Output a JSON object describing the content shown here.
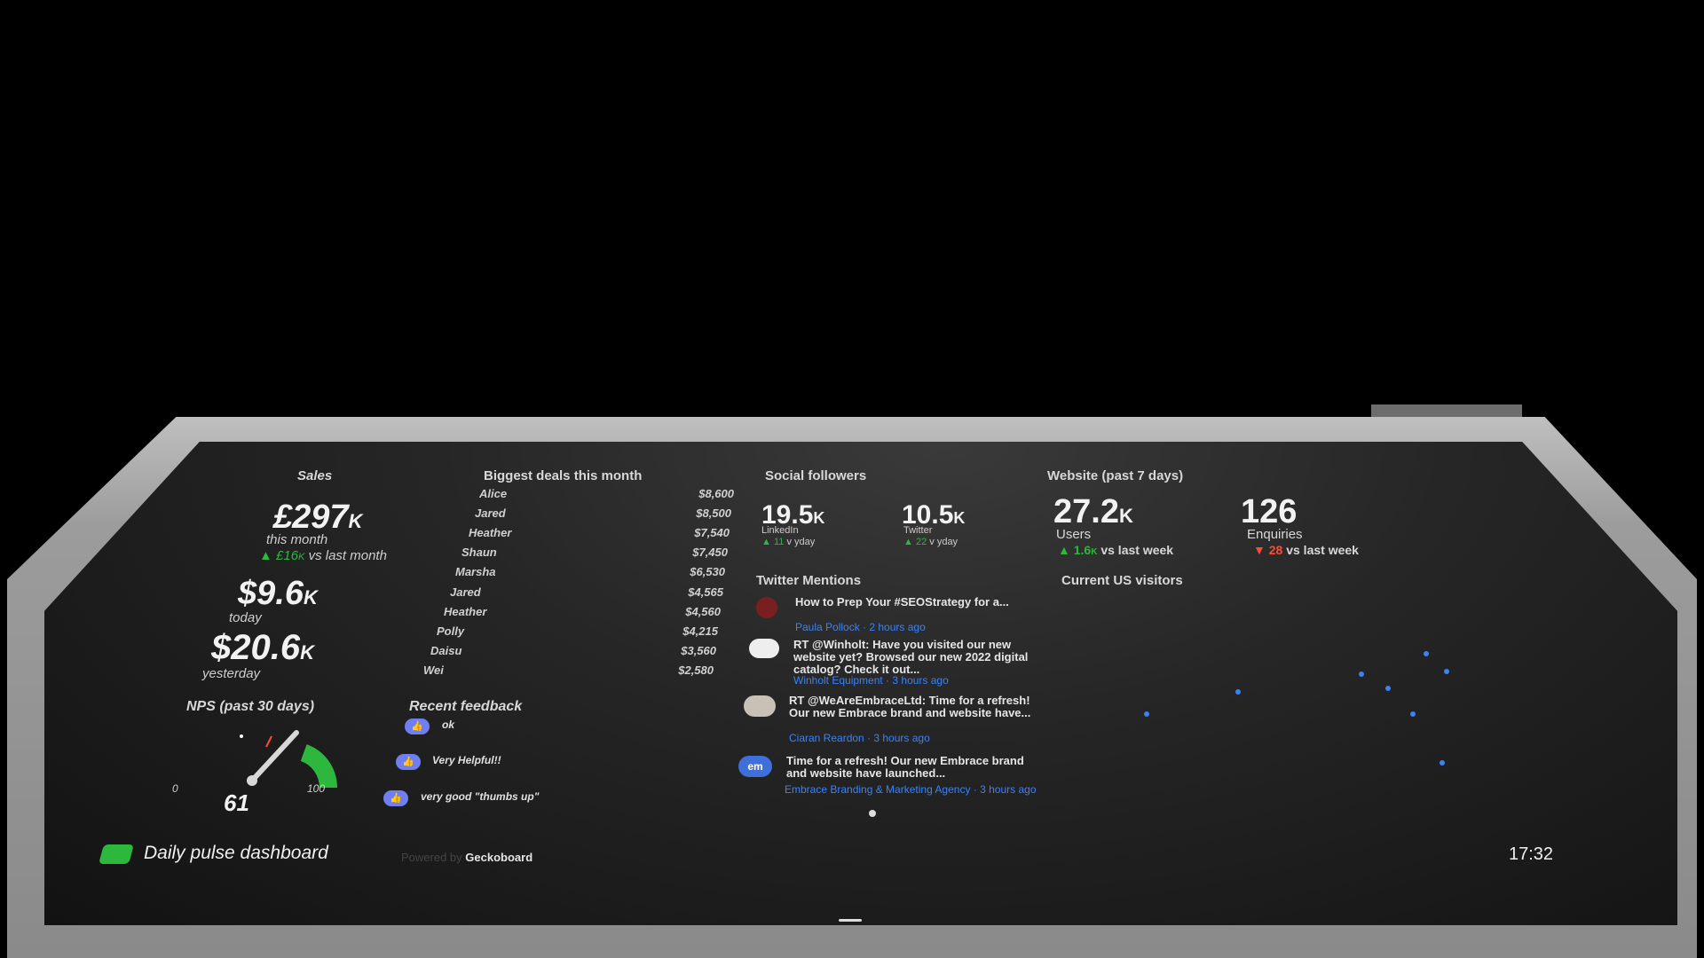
{
  "sales": {
    "title": "Sales",
    "month_value": "£297",
    "month_unit": "K",
    "month_label": "this month",
    "month_delta": "£16",
    "month_delta_unit": "K",
    "month_delta_label": "vs last month",
    "today_value": "$9.6",
    "today_unit": "K",
    "today_label": "today",
    "yesterday_value": "$20.6",
    "yesterday_unit": "K",
    "yesterday_label": "yesterday"
  },
  "deals": {
    "title": "Biggest deals this month",
    "rows": [
      {
        "name": "Alice",
        "amount": "$8,600"
      },
      {
        "name": "Jared",
        "amount": "$8,500"
      },
      {
        "name": "Heather",
        "amount": "$7,540"
      },
      {
        "name": "Shaun",
        "amount": "$7,450"
      },
      {
        "name": "Marsha",
        "amount": "$6,530"
      },
      {
        "name": "Jared",
        "amount": "$4,565"
      },
      {
        "name": "Heather",
        "amount": "$4,560"
      },
      {
        "name": "Polly",
        "amount": "$4,215"
      },
      {
        "name": "Daisu",
        "amount": "$3,560"
      },
      {
        "name": "Wei",
        "amount": "$2,580"
      }
    ]
  },
  "social": {
    "title": "Social followers",
    "linkedin_value": "19.5",
    "linkedin_unit": "K",
    "linkedin_label": "LinkedIn",
    "linkedin_delta": "11",
    "linkedin_delta_label": "v yday",
    "twitter_value": "10.5",
    "twitter_unit": "K",
    "twitter_label": "Twitter",
    "twitter_delta": "22",
    "twitter_delta_label": "v yday"
  },
  "website": {
    "title": "Website (past 7 days)",
    "users_value": "27.2",
    "users_unit": "K",
    "users_label": "Users",
    "users_delta": "1.6",
    "users_delta_unit": "K",
    "users_delta_label": "vs last week",
    "enquiries_value": "126",
    "enquiries_label": "Enquiries",
    "enquiries_delta": "28",
    "enquiries_delta_label": "vs last week"
  },
  "mentions": {
    "title": "Twitter Mentions",
    "items": [
      {
        "text": "How to Prep Your #SEOStrategy for a...",
        "meta": "Paula Pollock · 2 hours ago"
      },
      {
        "text": "RT @Winholt: Have you visited our new website yet? Browsed our new 2022 digital catalog? Check it out...",
        "meta": "Winholt Equipment · 3 hours ago"
      },
      {
        "text": "RT @WeAreEmbraceLtd: Time for a refresh! Our new Embrace brand and website have...",
        "meta": "Ciaran Reardon · 3 hours ago"
      },
      {
        "text": "Time for a refresh! Our new Embrace brand and website have launched...",
        "meta": "Embrace Branding & Marketing Agency · 3 hours ago"
      }
    ],
    "embrace_avatar": "em"
  },
  "visitors": {
    "title": "Current US visitors"
  },
  "nps": {
    "title": "NPS (past 30 days)",
    "value": "61",
    "min": "0",
    "max": "100",
    "level": 0.61
  },
  "feedback": {
    "title": "Recent feedback",
    "items": [
      {
        "text": "ok"
      },
      {
        "text": "Very Helpful!!"
      },
      {
        "text": "very good \"thumbs up\""
      }
    ]
  },
  "footer": {
    "title": "Daily pulse dashboard",
    "powered_by": "Powered by",
    "brand": "Geckoboard",
    "time": "17:32"
  },
  "colors": {
    "accent_green": "#2db83d",
    "down_red": "#ff4a3a",
    "link_blue": "#3b82f6"
  }
}
